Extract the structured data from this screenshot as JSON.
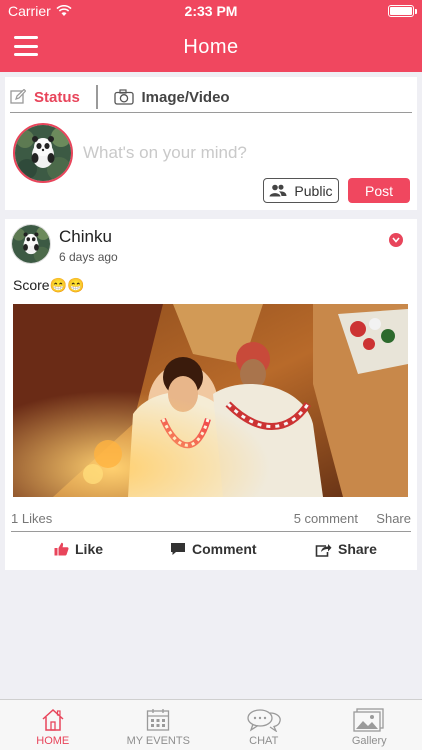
{
  "status_bar": {
    "carrier": "Carrier",
    "time": "2:33 PM"
  },
  "header": {
    "title": "Home",
    "accent": "#f0475f"
  },
  "composer": {
    "tab_status": "Status",
    "tab_media": "Image/Video",
    "placeholder": "What's on your mind?",
    "public_label": "Public",
    "post_label": "Post"
  },
  "post": {
    "author": "Chinku",
    "time_ago": "6 days ago",
    "caption": "Score😁😁",
    "likes": "1 Likes",
    "comments": "5 comment",
    "share_count": "Share",
    "actions": {
      "like": "Like",
      "comment": "Comment",
      "share": "Share"
    }
  },
  "tabbar": {
    "items": [
      {
        "label": "HOME",
        "icon": "home-icon",
        "active": true
      },
      {
        "label": "MY EVENTS",
        "icon": "calendar-icon",
        "active": false
      },
      {
        "label": "CHAT",
        "icon": "chat-icon",
        "active": false
      },
      {
        "label": "Gallery",
        "icon": "gallery-icon",
        "active": false
      }
    ]
  }
}
